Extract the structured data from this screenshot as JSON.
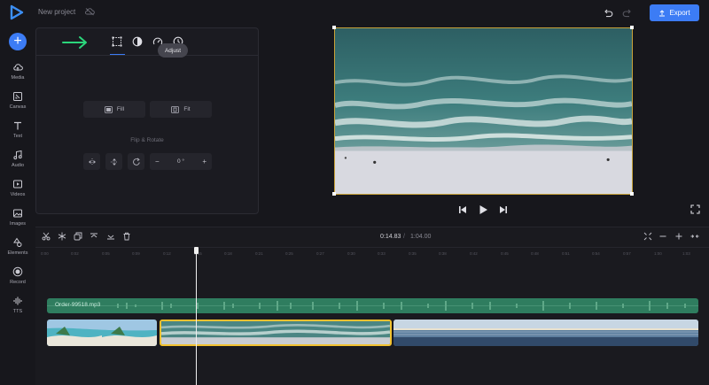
{
  "topbar": {
    "project_name": "New project",
    "export_label": "Export"
  },
  "sidebar": {
    "items": [
      {
        "label": "Media",
        "icon": "cloud-upload-icon"
      },
      {
        "label": "Canvas",
        "icon": "canvas-icon"
      },
      {
        "label": "Text",
        "icon": "text-icon"
      },
      {
        "label": "Audio",
        "icon": "music-note-icon"
      },
      {
        "label": "Videos",
        "icon": "video-icon"
      },
      {
        "label": "Images",
        "icon": "image-icon"
      },
      {
        "label": "Elements",
        "icon": "shapes-icon"
      },
      {
        "label": "Record",
        "icon": "record-icon"
      },
      {
        "label": "TTS",
        "icon": "waveform-icon"
      }
    ]
  },
  "panel": {
    "tooltip": "Adjust",
    "fill_label": "Fill",
    "fit_label": "Fit",
    "flip_rotate_title": "Flip & Rotate",
    "rotation_value": "0 °"
  },
  "timeline": {
    "current_time": "0:14.83",
    "separator": "/",
    "total_time": "1:04.00",
    "ruler": [
      "0:00",
      "0:02",
      "0:05",
      "0:09",
      "0:12",
      "0:15",
      "0:18",
      "0:21",
      "0:25",
      "0:27",
      "0:30",
      "0:33",
      "0:35",
      "0:38",
      "0:42",
      "0:45",
      "0:48",
      "0:51",
      "0:54",
      "0:57",
      "1:00",
      "1:03"
    ],
    "audio_clip_name": "Order-99518.mp3"
  },
  "colors": {
    "accent": "#3c7cf5",
    "audio_track": "#2f7d5f",
    "selection": "#f2c230",
    "panel_arrow": "#2bd67b"
  }
}
